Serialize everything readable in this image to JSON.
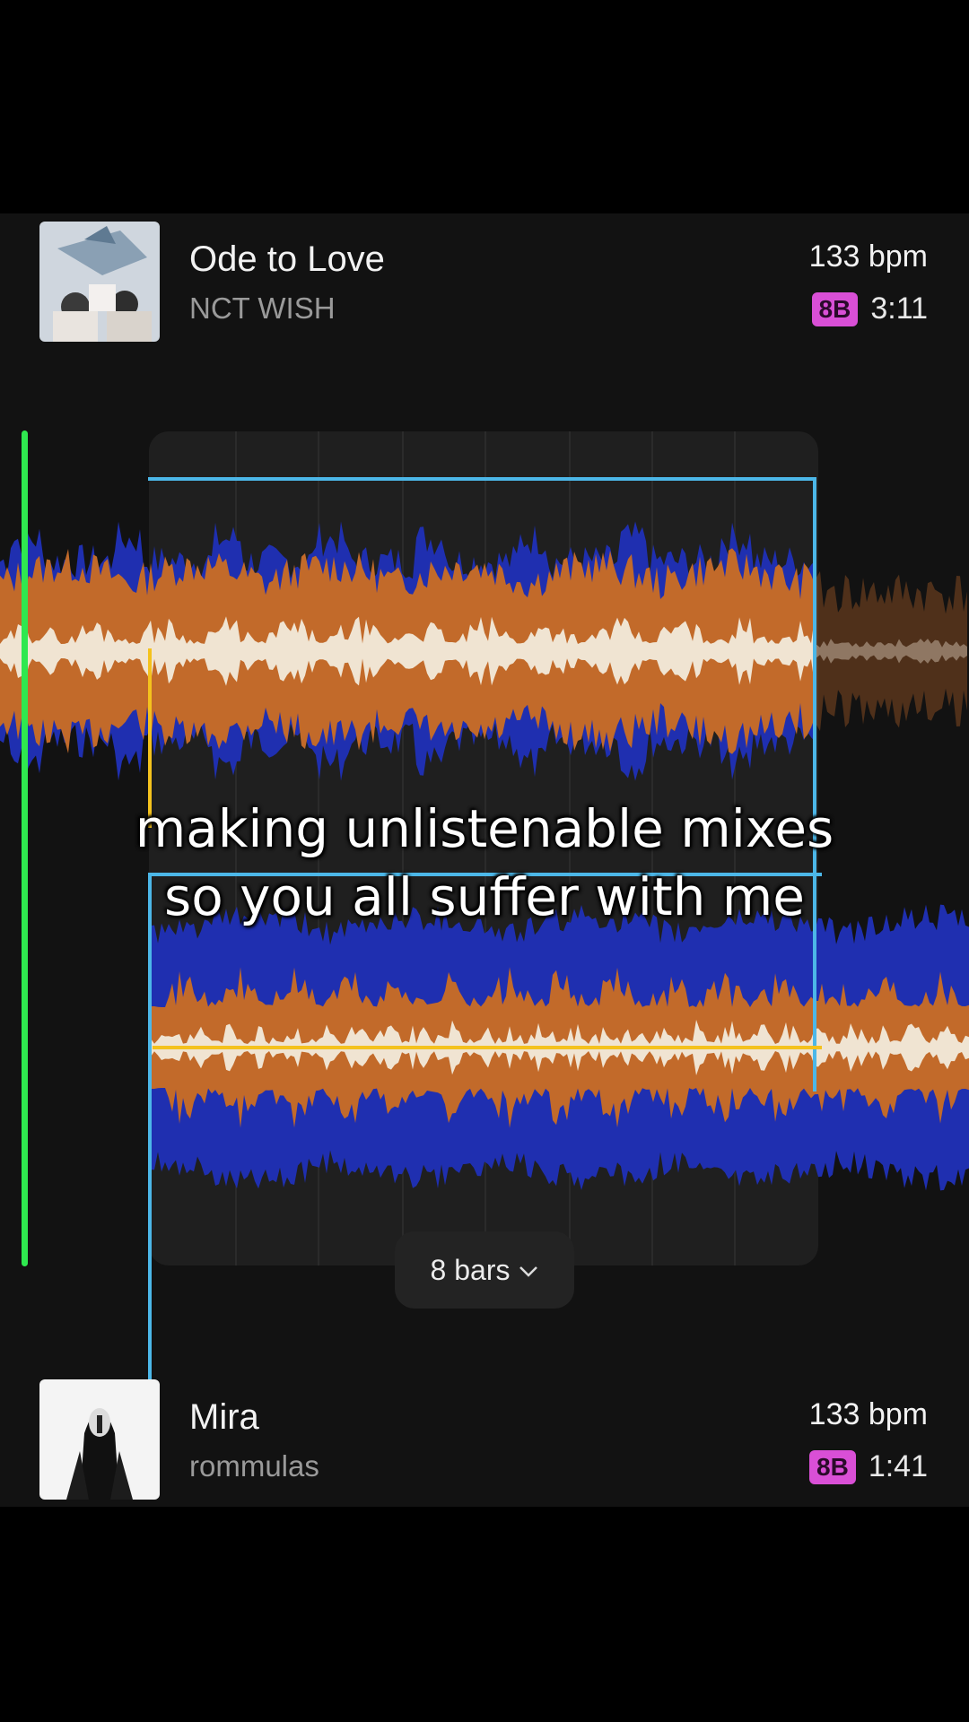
{
  "deck_top": {
    "title": "Ode to Love",
    "artist": "NCT WISH",
    "bpm": "133 bpm",
    "key": "8B",
    "duration": "3:11"
  },
  "deck_bottom": {
    "title": "Mira",
    "artist": "rommulas",
    "bpm": "133 bpm",
    "key": "8B",
    "duration": "1:41"
  },
  "loop": {
    "label": "8 bars"
  },
  "caption": {
    "line1": "making unlistenable mixes",
    "line2": "so you all suffer with me"
  },
  "colors": {
    "playhead": "#2fe84f",
    "loop_outline": "#4cb7e8",
    "cue": "#f4c21d",
    "key_badge": "#d94fd6",
    "wave_low": "#1f2fb0",
    "wave_mid": "#c26a2a",
    "wave_high": "#f0e4d2"
  },
  "icons": {
    "bars_dropdown": "chevron-down-icon"
  }
}
